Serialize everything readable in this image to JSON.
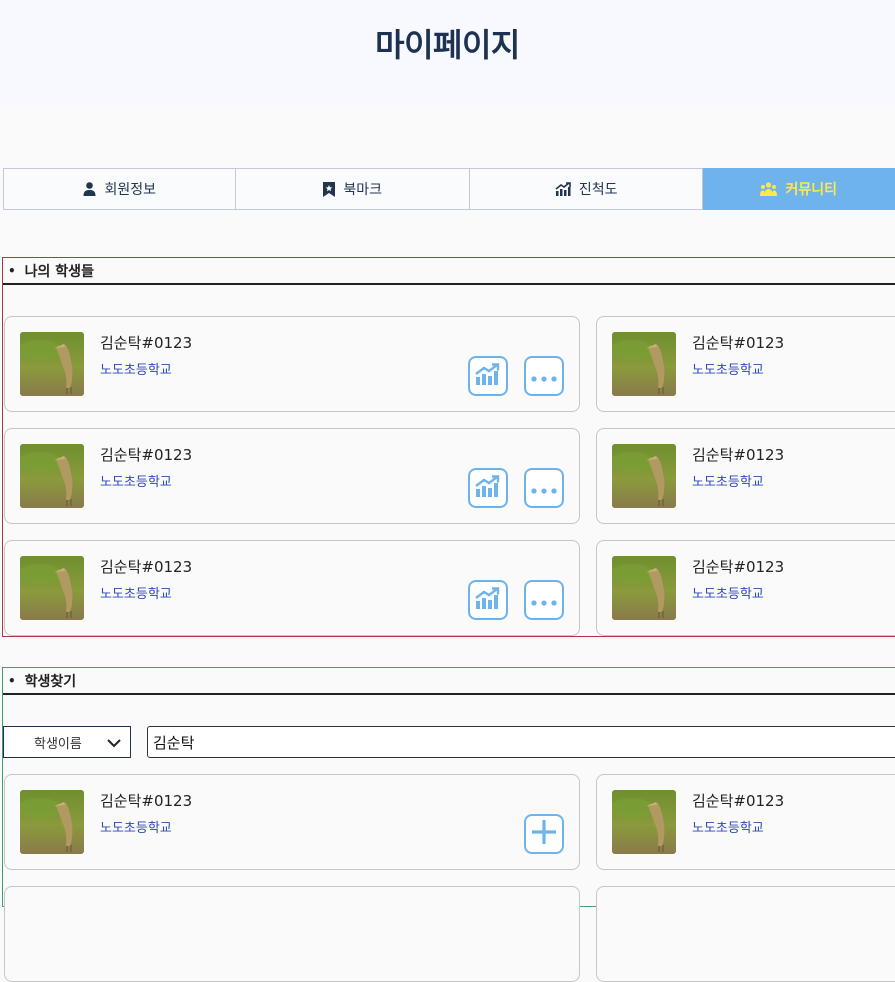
{
  "header": {
    "title": "마이페이지"
  },
  "tabs": [
    {
      "label": "회원정보",
      "icon": "user-icon",
      "active": false
    },
    {
      "label": "북마크",
      "icon": "bookmark-icon",
      "active": false
    },
    {
      "label": "진척도",
      "icon": "progress-chart-icon",
      "active": false
    },
    {
      "label": "커뮤니티",
      "icon": "community-icon",
      "active": true
    }
  ],
  "students_section": {
    "title": "나의 학생들",
    "cards": [
      {
        "name": "김순탁#0123",
        "school": "노도초등학교"
      },
      {
        "name": "김순탁#0123",
        "school": "노도초등학교"
      },
      {
        "name": "김순탁#0123",
        "school": "노도초등학교"
      },
      {
        "name": "김순탁#0123",
        "school": "노도초등학교"
      },
      {
        "name": "김순탁#0123",
        "school": "노도초등학교"
      },
      {
        "name": "김순탁#0123",
        "school": "노도초등학교"
      }
    ]
  },
  "search_section": {
    "title": "학생찾기",
    "filter_selected": "학생이름",
    "search_value": "김순탁",
    "cards": [
      {
        "name": "김순탁#0123",
        "school": "노도초등학교"
      },
      {
        "name": "김순탁#0123",
        "school": "노도초등학교"
      }
    ]
  },
  "colors": {
    "accent": "#6eb3ec",
    "active_tab_text": "#ffe94a",
    "title": "#1c3250",
    "school_text": "#2f49b0",
    "students_border": "#b3353d",
    "search_border": "#3aa36d"
  }
}
